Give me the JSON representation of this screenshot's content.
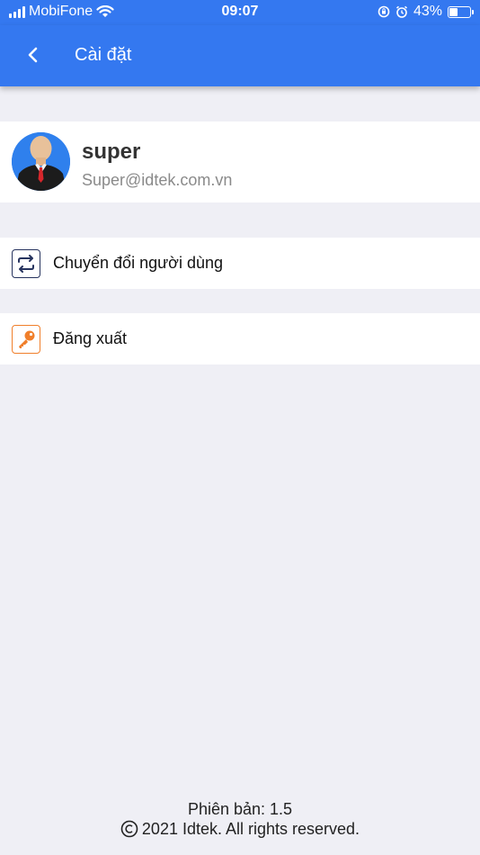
{
  "status_bar": {
    "carrier": "MobiFone",
    "time": "09:07",
    "battery_percent": "43%",
    "battery_level": 0.43
  },
  "app_bar": {
    "title": "Cài đặt"
  },
  "profile": {
    "name": "super",
    "email": "Super@idtek.com.vn"
  },
  "menu": {
    "items": [
      {
        "label": "Chuyển đổi người dùng",
        "icon": "switch-user-icon"
      },
      {
        "label": "Đăng xuất",
        "icon": "key-icon"
      }
    ]
  },
  "footer": {
    "version": "Phiên bản: 1.5",
    "copyright": "2021 Idtek. All rights reserved."
  },
  "colors": {
    "primary": "#3478f0",
    "background": "#efeff5",
    "switch_icon": "#26335e",
    "key_icon": "#f07f2b"
  }
}
